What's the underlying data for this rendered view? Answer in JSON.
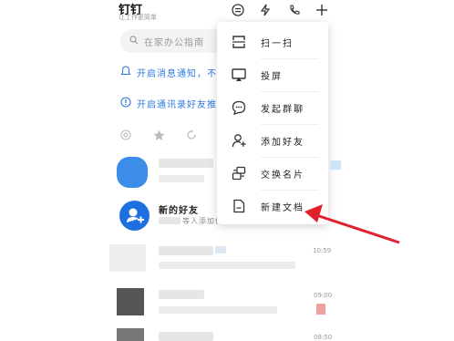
{
  "header": {
    "title": "钉钉",
    "subtitle": "让工作更简单"
  },
  "search": {
    "placeholder": "在家办公指南"
  },
  "notices": [
    {
      "text": "开启消息通知，不错过重要消息"
    },
    {
      "text": "开启通讯录好友推荐"
    }
  ],
  "chat_items": [
    {
      "title": "新的好友",
      "preview": "等人添加你为好友"
    }
  ],
  "times": [
    "10:59",
    "09:00",
    "08:50"
  ],
  "menu": {
    "items": [
      {
        "label": "扫一扫",
        "icon": "scan-icon"
      },
      {
        "label": "投屏",
        "icon": "screencast-icon"
      },
      {
        "label": "发起群聊",
        "icon": "group-chat-icon"
      },
      {
        "label": "添加好友",
        "icon": "add-friend-icon"
      },
      {
        "label": "交换名片",
        "icon": "exchange-card-icon"
      },
      {
        "label": "新建文档",
        "icon": "new-doc-icon"
      }
    ]
  },
  "colors": {
    "accent": "#2b7be0",
    "annotation_arrow": "#e0202b"
  }
}
